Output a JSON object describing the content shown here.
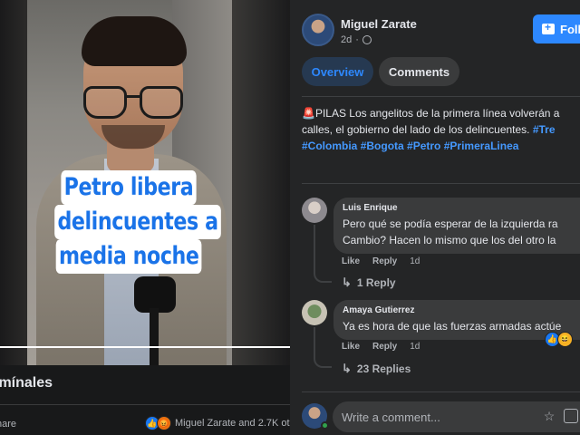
{
  "video": {
    "caption_lines": [
      "Petro libera",
      "delincuentes a",
      "media noche"
    ],
    "progress": 1.0,
    "title": "ímínales",
    "share_label": "hare",
    "reactions_text": "Miguel Zarate and 2.7K ot"
  },
  "post": {
    "author": "Miguel Zarate",
    "time": "2d",
    "follow_label": "Foll",
    "tabs": [
      "Overview",
      "Comments"
    ],
    "emoji": "🚨",
    "text_line1": "PILAS Los angelitos de la primera línea volverán a",
    "text_line2_plain": "calles, el gobierno del lado de los delincuentes. ",
    "text_line2_tag": "#Tre",
    "hashtags_line3": [
      "#Colombia",
      "#Bogota",
      "#Petro",
      "#PrimeraLinea"
    ]
  },
  "comments": [
    {
      "name": "Luis Enrique",
      "line1": "Pero qué se podía esperar de la izquierda ra",
      "line2": "Cambio? Hacen lo mismo que los del otro la",
      "like_label": "Like",
      "reply_label": "Reply",
      "time": "1d",
      "replies_label": "1 Reply"
    },
    {
      "name": "Amaya Gutierrez",
      "line1": "Ya es hora de que las fuerzas armadas actúe",
      "like_label": "Like",
      "reply_label": "Reply",
      "time": "1d",
      "replies_label": "23 Replies"
    }
  ],
  "composer": {
    "placeholder": "Write a comment..."
  },
  "colors": {
    "accent": "#2d88ff",
    "caption_text": "#1a73e8",
    "panel_bg": "#242526",
    "page_bg": "#18191a"
  }
}
